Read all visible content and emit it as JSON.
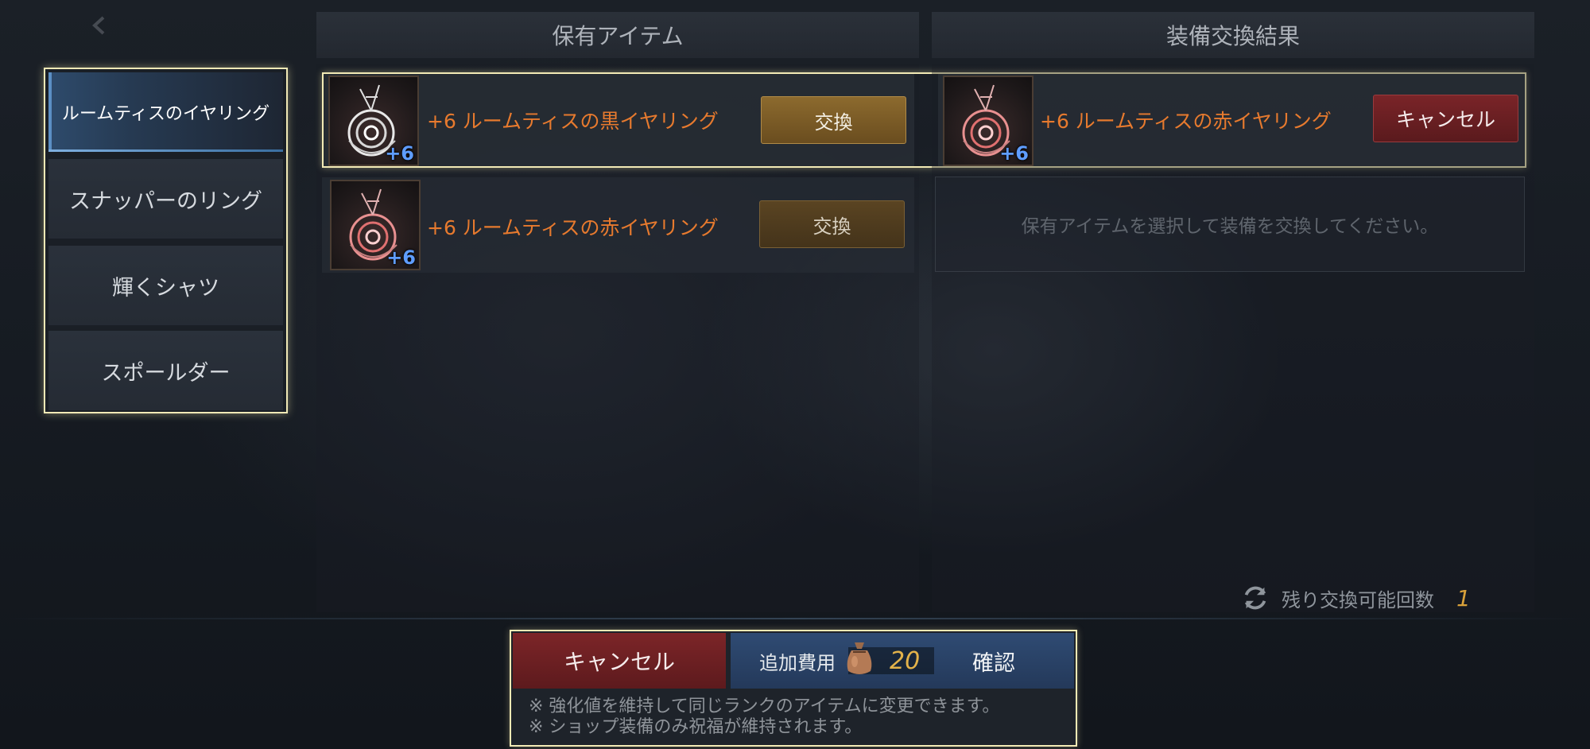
{
  "header": {
    "title": "保有アイテム"
  },
  "tabs": [
    {
      "label": "ルームティスのイヤリング",
      "active": true
    },
    {
      "label": "スナッパーのリング",
      "active": false
    },
    {
      "label": "輝くシャツ",
      "active": false
    },
    {
      "label": "スポールダー",
      "active": false
    }
  ],
  "owned": {
    "header": "保有アイテム",
    "items": [
      {
        "enhance": "+6",
        "name": "+6 ルームティスの黒イヤリング",
        "button": "交換",
        "selected": true,
        "icon": "black-earring-icon"
      },
      {
        "enhance": "+6",
        "name": "+6 ルームティスの赤イヤリング",
        "button": "交換",
        "selected": false,
        "icon": "red-earring-icon"
      }
    ]
  },
  "result": {
    "header": "装備交換結果",
    "item": {
      "enhance": "+6",
      "name": "+6 ルームティスの赤イヤリング",
      "button": "キャンセル",
      "icon": "red-earring-icon"
    },
    "placeholder": "保有アイテムを選択して装備を交換してください。"
  },
  "remaining": {
    "label": "残り交換可能回数",
    "value": "1",
    "icon": "refresh-icon"
  },
  "dialog": {
    "cancel_label": "キャンセル",
    "cost_label": "追加費用",
    "cost_value": "20",
    "cost_icon": "bag-icon",
    "confirm_label": "確認",
    "notes": [
      "※  強化値を維持して同じランクのアイテムに変更できます。",
      "※  ショップ装備のみ祝福が維持されます。"
    ]
  },
  "colors": {
    "highlight_border": "#f2eab5",
    "item_name": "#e77a2e",
    "enhance_badge": "#5f9dff",
    "cost_value": "#e3b24a"
  }
}
